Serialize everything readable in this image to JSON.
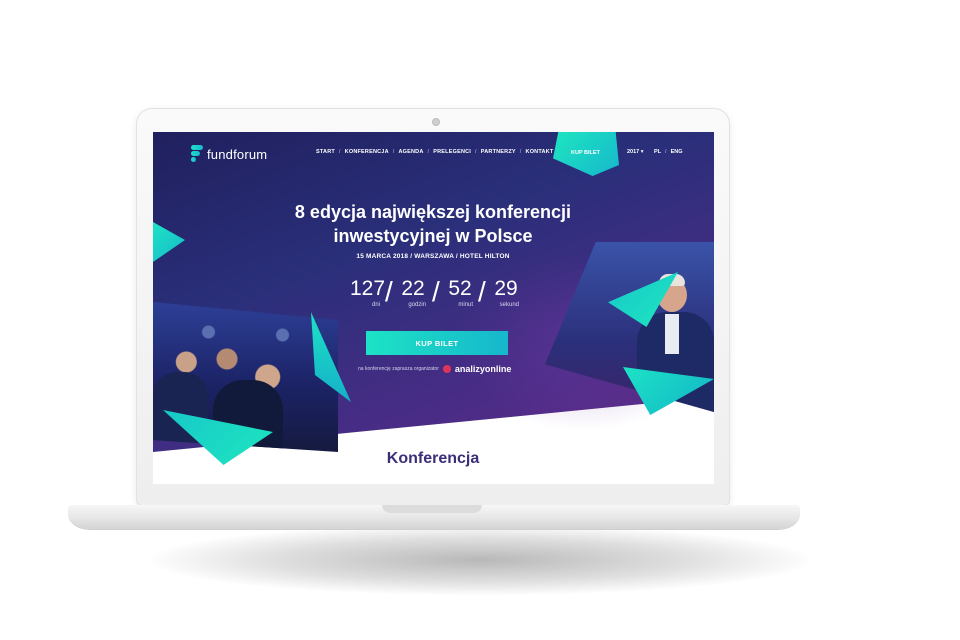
{
  "site": {
    "logo_text": "fundforum"
  },
  "nav": {
    "items": [
      "START",
      "KONFERENCJA",
      "AGENDA",
      "PRELEGENCI",
      "PARTNERZY",
      "KONTAKT"
    ],
    "separator": "/",
    "ticket_label": "KUP BILET",
    "year": "2017 ▾",
    "languages": [
      "PL",
      "ENG"
    ]
  },
  "hero": {
    "headline": "8 edycja największej konferencji inwestycyjnej w Polsce",
    "subline": "15 MARCA 2018 / WARSZAWA / HOTEL HILTON",
    "countdown": [
      {
        "value": "127",
        "label": "dni"
      },
      {
        "value": "22",
        "label": "godzin"
      },
      {
        "value": "52",
        "label": "minut"
      },
      {
        "value": "29",
        "label": "sekund"
      }
    ],
    "countdown_separator": "/",
    "cta_label": "KUP BILET",
    "organizer_text": "na konferencję zaprasza organizator",
    "organizer_name": "analizyonline"
  },
  "section": {
    "title": "Konferencja"
  },
  "colors": {
    "accent": "#1de3c5",
    "hero_dark": "#20205e",
    "hero_purple": "#6e2a8a",
    "title": "#3a2f7a"
  }
}
